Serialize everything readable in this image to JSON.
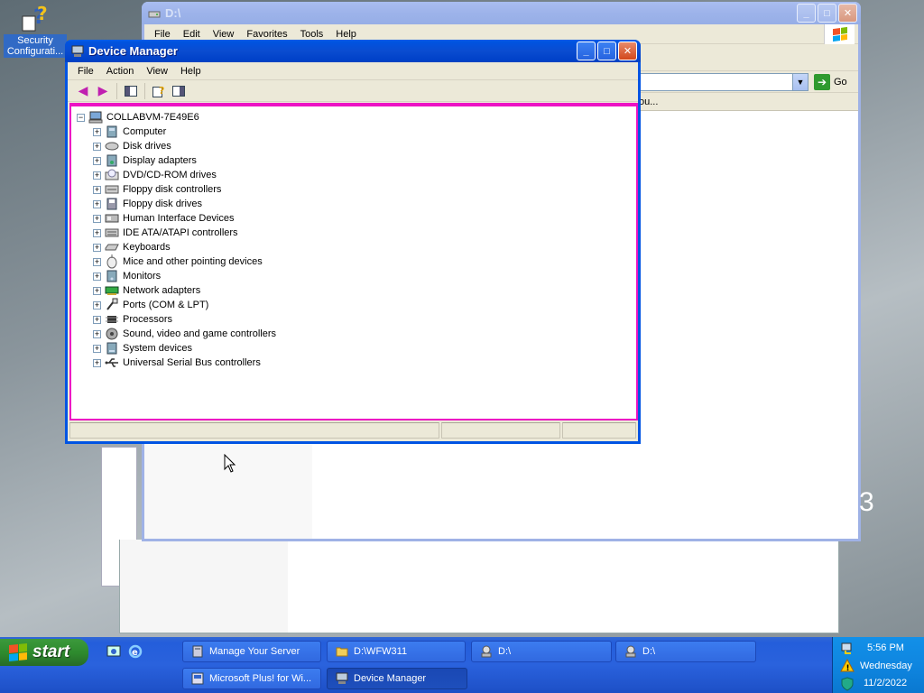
{
  "desktop": {
    "icons": [
      {
        "label": "Security Configurati...",
        "icon": "help-icon"
      }
    ]
  },
  "d_window": {
    "title": "D:\\",
    "menus": [
      "File",
      "Edit",
      "View",
      "Favorites",
      "Tools",
      "Help"
    ],
    "go_label": "Go",
    "column_partial": "ou..."
  },
  "device_manager": {
    "title": "Device Manager",
    "menus": [
      "File",
      "Action",
      "View",
      "Help"
    ],
    "root": "COLLABVM-7E49E6",
    "categories": [
      {
        "label": "Computer",
        "icon": "computer-icon"
      },
      {
        "label": "Disk drives",
        "icon": "disk-drive-icon"
      },
      {
        "label": "Display adapters",
        "icon": "display-adapter-icon"
      },
      {
        "label": "DVD/CD-ROM drives",
        "icon": "cdrom-icon"
      },
      {
        "label": "Floppy disk controllers",
        "icon": "floppy-controller-icon"
      },
      {
        "label": "Floppy disk drives",
        "icon": "floppy-drive-icon"
      },
      {
        "label": "Human Interface Devices",
        "icon": "hid-icon"
      },
      {
        "label": "IDE ATA/ATAPI controllers",
        "icon": "ide-controller-icon"
      },
      {
        "label": "Keyboards",
        "icon": "keyboard-icon"
      },
      {
        "label": "Mice and other pointing devices",
        "icon": "mouse-icon"
      },
      {
        "label": "Monitors",
        "icon": "monitor-icon"
      },
      {
        "label": "Network adapters",
        "icon": "network-adapter-icon"
      },
      {
        "label": "Ports (COM & LPT)",
        "icon": "port-icon"
      },
      {
        "label": "Processors",
        "icon": "processor-icon"
      },
      {
        "label": "Sound, video and game controllers",
        "icon": "sound-icon"
      },
      {
        "label": "System devices",
        "icon": "system-device-icon"
      },
      {
        "label": "Universal Serial Bus controllers",
        "icon": "usb-icon"
      }
    ]
  },
  "taskbar": {
    "start_label": "start",
    "row1": [
      "Manage Your Server",
      "D:\\WFW311",
      "D:\\",
      "D:\\"
    ],
    "row2": [
      "Microsoft Plus! for Wi...",
      "Device Manager"
    ],
    "active": "Device Manager"
  },
  "tray": {
    "time": "5:56 PM",
    "day": "Wednesday",
    "date": "11/2/2022"
  },
  "background_fragment": "3",
  "colors": {
    "xp_blue": "#0054e3",
    "selection_border": "#ec12c4",
    "start_green": "#2e8b2e",
    "tray_blue": "#0f86e0"
  }
}
